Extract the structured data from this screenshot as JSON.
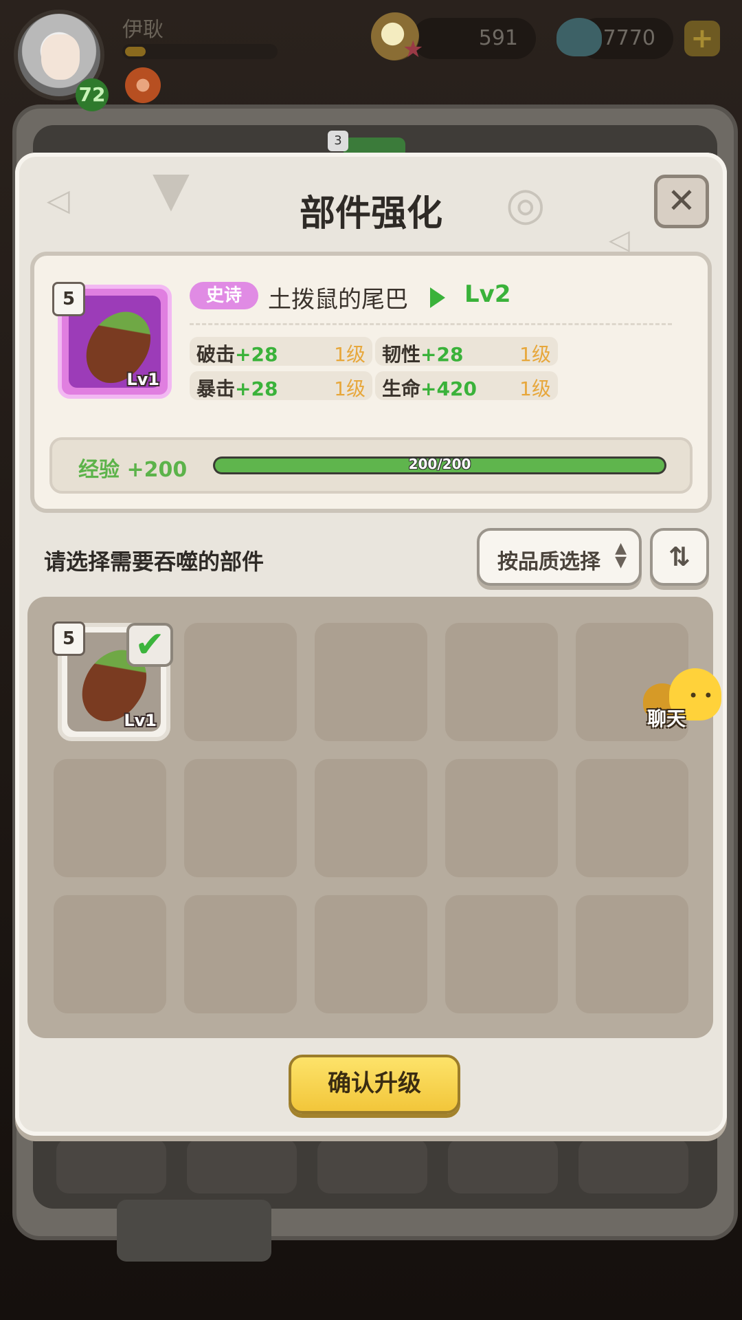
{
  "hud": {
    "player_name": "伊耿",
    "player_level": "72",
    "gems": "591",
    "shells": "7770",
    "add_icon": "plus-icon"
  },
  "background": {
    "badge_count": "3"
  },
  "modal": {
    "title": "部件强化",
    "close_icon": "close-icon"
  },
  "item": {
    "count": "5",
    "level_tag": "Lv1",
    "rarity": "史诗",
    "rarity_color": "#e08be4",
    "name": "土拨鼠的尾巴",
    "next_level": "Lv2",
    "stats": [
      {
        "name": "破击",
        "value": "+28",
        "level": "1级"
      },
      {
        "name": "韧性",
        "value": "+28",
        "level": "1级"
      },
      {
        "name": "暴击",
        "value": "+28",
        "level": "1级"
      },
      {
        "name": "生命",
        "value": "+420",
        "level": "1级"
      }
    ],
    "exp_label": "经验",
    "exp_gain": "+200",
    "exp_text": "200/200",
    "exp_progress": 1.0
  },
  "selection": {
    "prompt": "请选择需要吞噬的部件",
    "filter_label": "按品质选择",
    "sort_icon": "sort-icon",
    "slots": [
      {
        "filled": true,
        "count": "5",
        "level_tag": "Lv1",
        "checked": true
      }
    ],
    "total_slots": 15
  },
  "chat": {
    "label": "聊天"
  },
  "confirm_label": "确认升级",
  "colors": {
    "accent_green": "#3ab23a",
    "level_orange": "#e7a73b",
    "confirm_yellow": "#f2c63a"
  }
}
